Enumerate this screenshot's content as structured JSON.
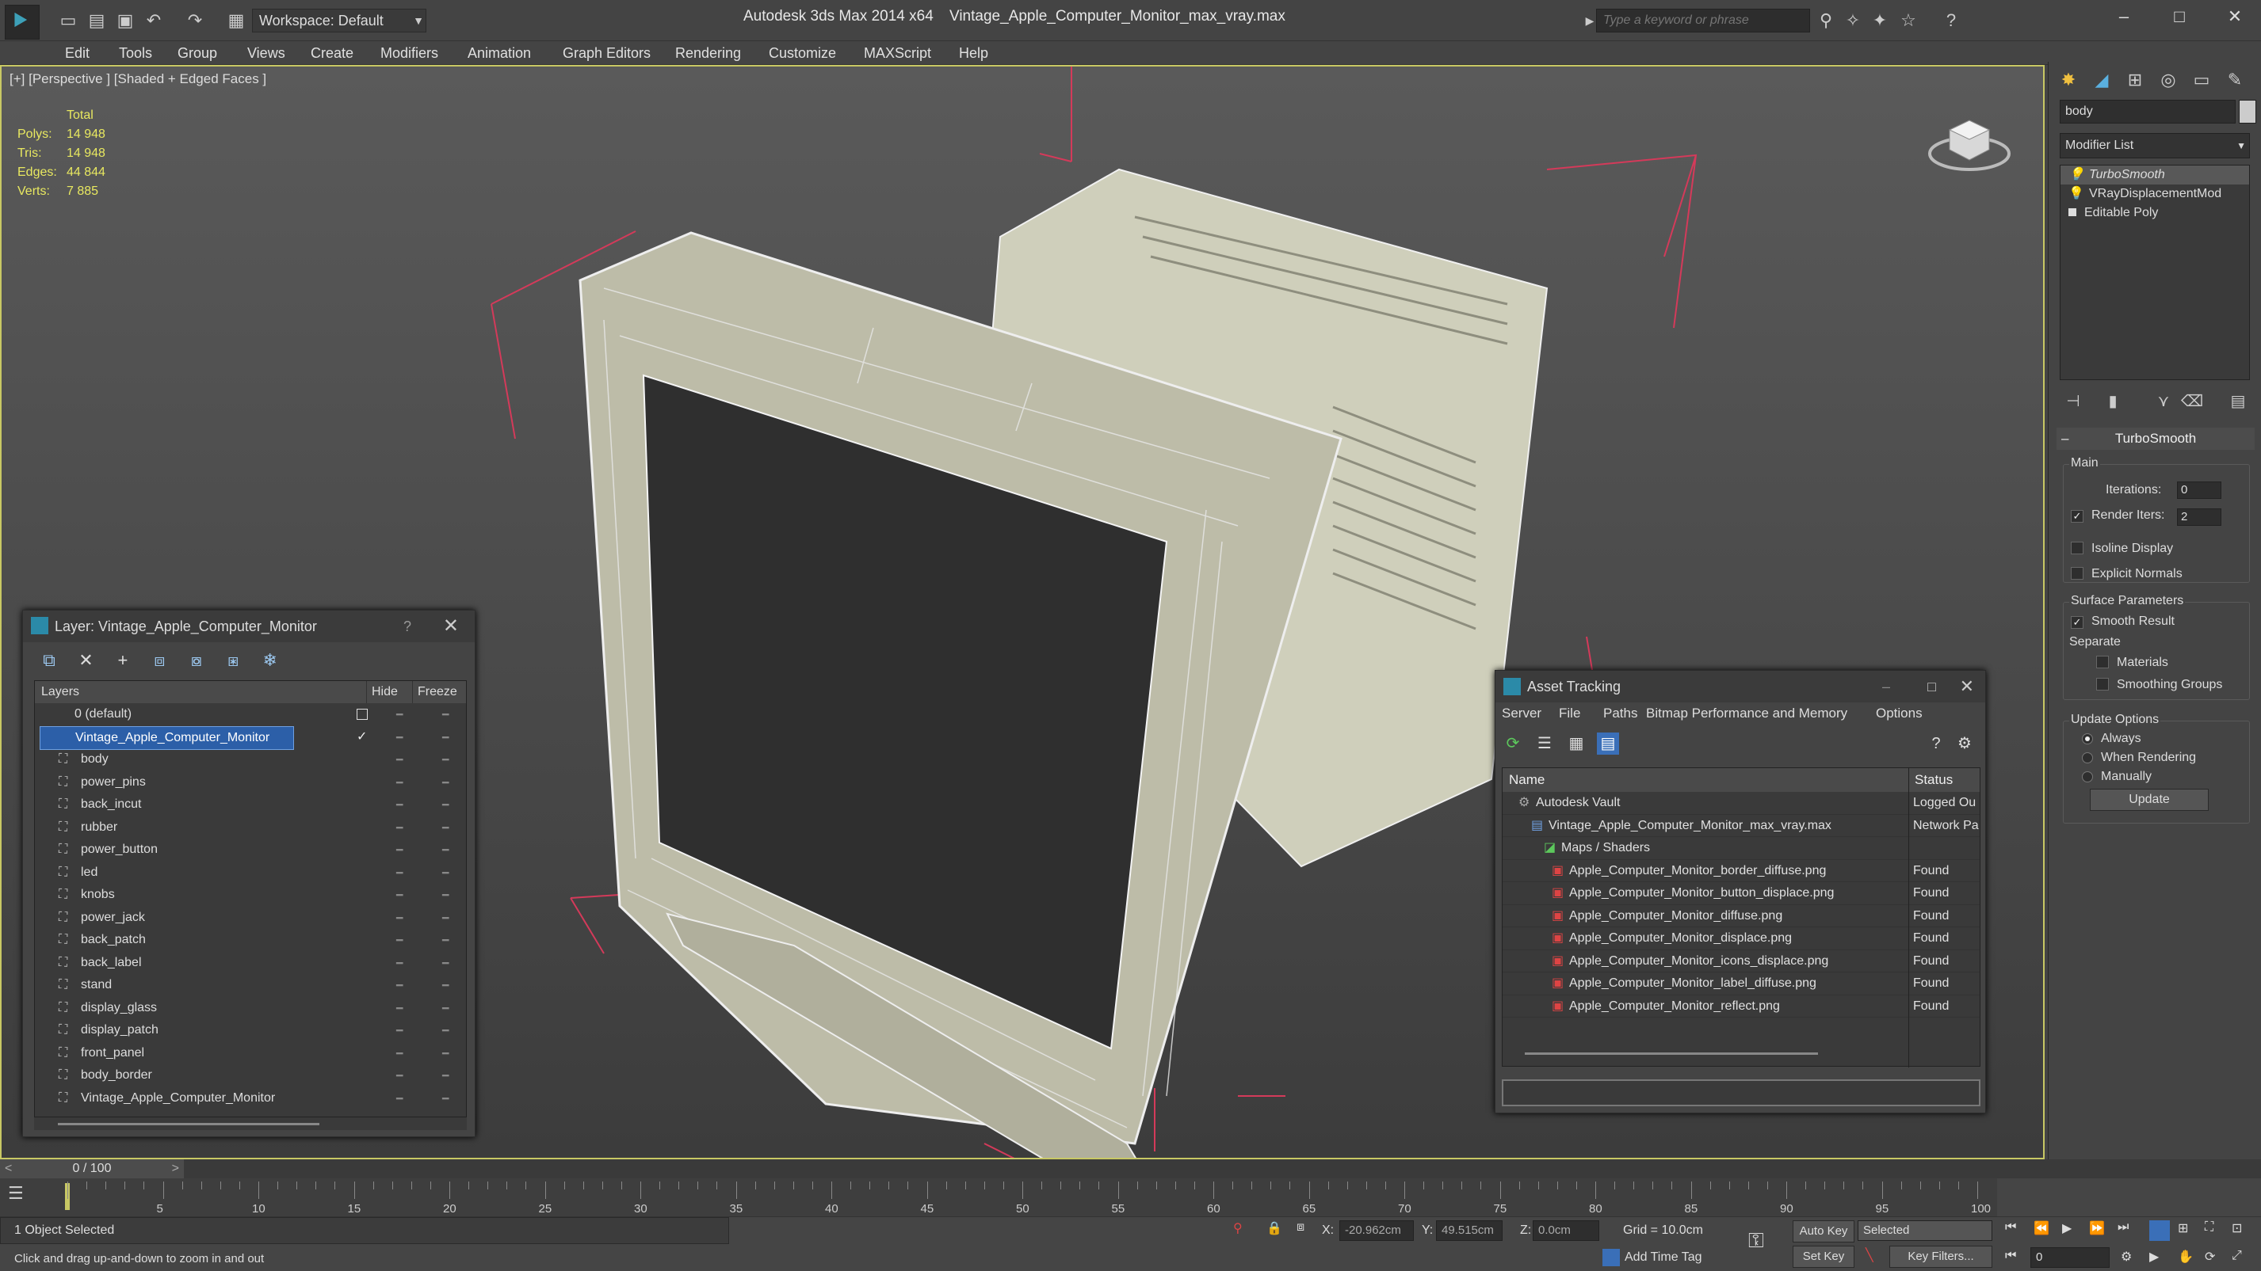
{
  "titlebar": {
    "workspace": "Workspace: Default",
    "app_title": "Autodesk 3ds Max  2014 x64",
    "doc_title": "Vintage_Apple_Computer_Monitor_max_vray.max",
    "search_placeholder": "Type a keyword or phrase"
  },
  "menu": [
    "Edit",
    "Tools",
    "Group",
    "Views",
    "Create",
    "Modifiers",
    "Animation",
    "Graph Editors",
    "Rendering",
    "Customize",
    "MAXScript",
    "Help"
  ],
  "viewport": {
    "label": "[+] [Perspective ] [Shaded + Edged Faces ]",
    "stats_header": "Total",
    "stats": [
      {
        "k": "Polys:",
        "v": "14 948"
      },
      {
        "k": "Tris:",
        "v": "14 948"
      },
      {
        "k": "Edges:",
        "v": "44 844"
      },
      {
        "k": "Verts:",
        "v": "7 885"
      }
    ]
  },
  "layer_dialog": {
    "title": "Layer: Vintage_Apple_Computer_Monitor",
    "help": "?",
    "col_layers": "Layers",
    "col_hide": "Hide",
    "col_freeze": "Freeze",
    "default_layer": "0 (default)",
    "selected_layer": "Vintage_Apple_Computer_Monitor",
    "objects": [
      "body",
      "power_pins",
      "back_incut",
      "rubber",
      "power_button",
      "led",
      "knobs",
      "power_jack",
      "back_patch",
      "back_label",
      "stand",
      "display_glass",
      "display_patch",
      "front_panel",
      "body_border",
      "Vintage_Apple_Computer_Monitor"
    ]
  },
  "asset_tracking": {
    "title": "Asset Tracking",
    "menu": [
      "Server",
      "File",
      "Paths",
      "Bitmap Performance and Memory",
      "Options"
    ],
    "col_name": "Name",
    "col_status": "Status",
    "rows": [
      {
        "name": "Autodesk Vault",
        "status": "Logged Ou",
        "indent": 0
      },
      {
        "name": "Vintage_Apple_Computer_Monitor_max_vray.max",
        "status": "Network Pa",
        "indent": 1
      },
      {
        "name": "Maps / Shaders",
        "status": "",
        "indent": 2
      },
      {
        "name": "Apple_Computer_Monitor_border_diffuse.png",
        "status": "Found",
        "indent": 3
      },
      {
        "name": "Apple_Computer_Monitor_button_displace.png",
        "status": "Found",
        "indent": 3
      },
      {
        "name": "Apple_Computer_Monitor_diffuse.png",
        "status": "Found",
        "indent": 3
      },
      {
        "name": "Apple_Computer_Monitor_displace.png",
        "status": "Found",
        "indent": 3
      },
      {
        "name": "Apple_Computer_Monitor_icons_displace.png",
        "status": "Found",
        "indent": 3
      },
      {
        "name": "Apple_Computer_Monitor_label_diffuse.png",
        "status": "Found",
        "indent": 3
      },
      {
        "name": "Apple_Computer_Monitor_reflect.png",
        "status": "Found",
        "indent": 3
      }
    ]
  },
  "command_panel": {
    "object_name": "body",
    "modifier_list": "Modifier List",
    "stack": [
      "TurboSmooth",
      "VRayDisplacementMod",
      "Editable Poly"
    ],
    "rollout": "TurboSmooth",
    "main": "Main",
    "iterations_label": "Iterations:",
    "iterations": "0",
    "render_iters_label": "Render Iters:",
    "render_iters": "2",
    "isoline": "Isoline Display",
    "explicit": "Explicit Normals",
    "surface_params": "Surface Parameters",
    "smooth_result": "Smooth Result",
    "separate": "Separate",
    "materials": "Materials",
    "smoothing_groups": "Smoothing Groups",
    "update_options": "Update Options",
    "always": "Always",
    "when_rendering": "When Rendering",
    "manually": "Manually",
    "update_btn": "Update"
  },
  "timeline": {
    "frame": "0 / 100",
    "ticks": [
      "5",
      "10",
      "15",
      "20",
      "25",
      "30",
      "35",
      "40",
      "45",
      "50",
      "55",
      "60",
      "65",
      "70",
      "75",
      "80",
      "85",
      "90",
      "95",
      "100"
    ]
  },
  "status": {
    "selected": "1 Object Selected",
    "prompt": "Click and drag up-and-down to zoom in and out",
    "x_label": "X:",
    "x": "-20.962cm",
    "y_label": "Y:",
    "y": "49.515cm",
    "z_label": "Z:",
    "z": "0.0cm",
    "grid": "Grid = 10.0cm",
    "auto_key": "Auto Key",
    "selected_dd": "Selected",
    "set_key": "Set Key",
    "key_filters": "Key Filters...",
    "add_time_tag": "Add Time Tag",
    "frame_field": "0"
  }
}
